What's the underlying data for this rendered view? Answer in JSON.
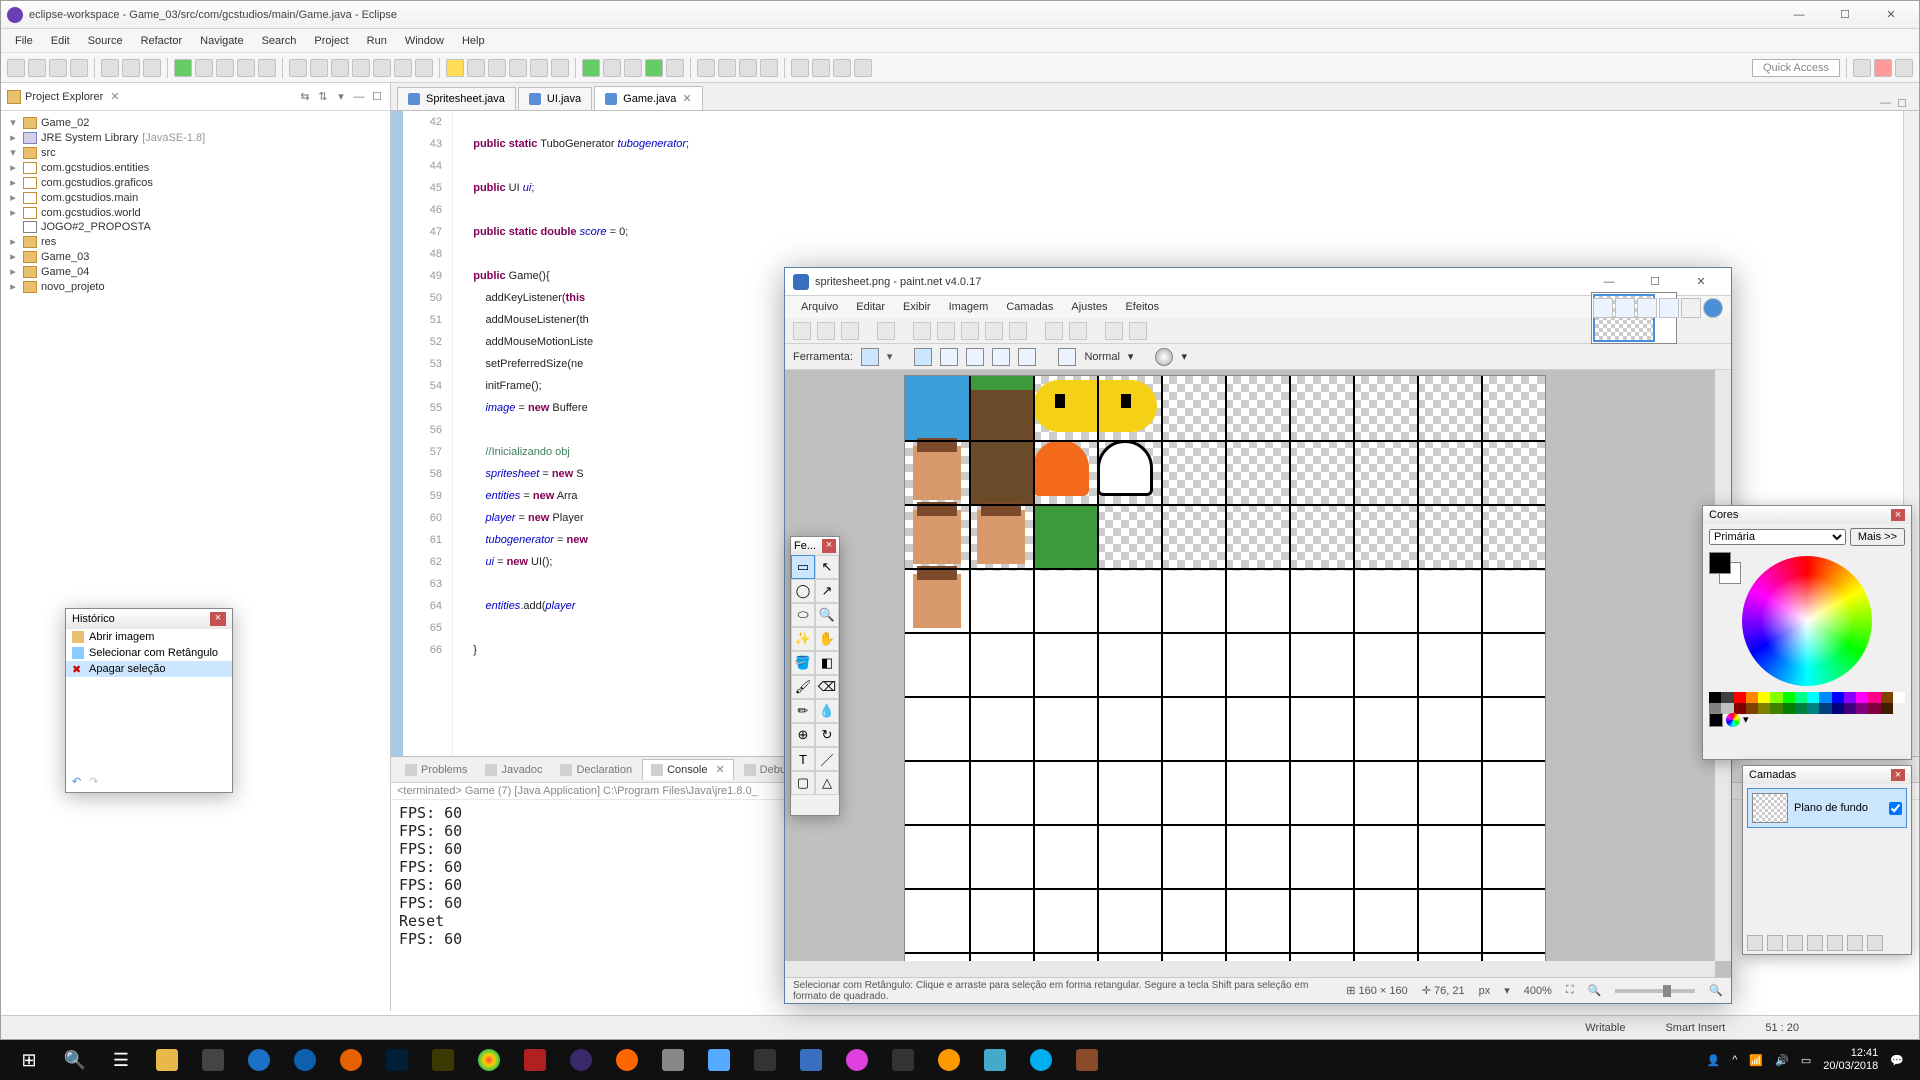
{
  "eclipse": {
    "title": "eclipse-workspace - Game_03/src/com/gcstudios/main/Game.java - Eclipse",
    "menu": [
      "File",
      "Edit",
      "Source",
      "Refactor",
      "Navigate",
      "Search",
      "Project",
      "Run",
      "Window",
      "Help"
    ],
    "quick_access": "Quick Access",
    "explorer": {
      "title": "Project Explorer",
      "tree": {
        "p0": "Game_02",
        "p0_lib": "JRE System Library",
        "p0_lib_v": "[JavaSE-1.8]",
        "p0_src": "src",
        "p0_pk1": "com.gcstudios.entities",
        "p0_pk2": "com.gcstudios.graficos",
        "p0_pk3": "com.gcstudios.main",
        "p0_pk4": "com.gcstudios.world",
        "p0_f1": "JOGO#2_PROPOSTA",
        "p0_res": "res",
        "p1": "Game_03",
        "p2": "Game_04",
        "p3": "novo_projeto"
      }
    },
    "tabs": [
      "Spritesheet.java",
      "UI.java",
      "Game.java"
    ],
    "active_tab": 2,
    "code_start_line": 42,
    "code_lines": [
      "",
      "    public static TuboGenerator tubogenerator;",
      "",
      "    public UI ui;",
      "",
      "    public static double score = 0;",
      "",
      "    public Game(){",
      "        addKeyListener(this",
      "        addMouseListener(th",
      "        addMouseMotionListe",
      "        setPreferredSize(ne",
      "        initFrame();",
      "        image = new Buffere",
      "",
      "        //Inicializando obj",
      "        spritesheet = new S",
      "        entities = new Arra",
      "        player = new Player",
      "        tubogenerator = new",
      "        ui = new UI();",
      "",
      "        entities.add(player",
      "",
      "    }"
    ],
    "bottom_tabs": [
      "Problems",
      "Javadoc",
      "Declaration",
      "Console",
      "Debug"
    ],
    "bottom_active": 3,
    "console_header": "<terminated> Game (7) [Java Application] C:\\Program Files\\Java\\jre1.8.0_",
    "console": [
      "FPS: 60",
      "FPS: 60",
      "FPS: 60",
      "FPS: 60",
      "FPS: 60",
      "FPS: 60",
      "Reset",
      "FPS: 60"
    ],
    "status": {
      "writable": "Writable",
      "insert": "Smart Insert",
      "pos": "51 : 20"
    }
  },
  "pdn": {
    "title": "spritesheet.png - paint.net v4.0.17",
    "menu": [
      "Arquivo",
      "Editar",
      "Exibir",
      "Imagem",
      "Camadas",
      "Ajustes",
      "Efeitos"
    ],
    "opt_label": "Ferramenta:",
    "opt_mode": "Normal",
    "status_hint": "Selecionar com Retângulo: Clique e arraste para seleção em forma retangular. Segure a tecla Shift para seleção em formato de quadrado.",
    "status_size": "160 × 160",
    "status_pos": "76, 21",
    "status_unit": "px",
    "status_zoom": "400%",
    "tools_title": "Fe...",
    "history": {
      "title": "Histórico",
      "items": [
        "Abrir imagem",
        "Selecionar com Retângulo",
        "Apagar seleção"
      ],
      "sel": 2
    },
    "colors": {
      "title": "Cores",
      "primary": "Primária",
      "more": "Mais >>"
    },
    "layers": {
      "title": "Camadas",
      "bg": "Plano de fundo"
    }
  },
  "taskbar": {
    "time": "12:41",
    "date": "20/03/2018"
  }
}
